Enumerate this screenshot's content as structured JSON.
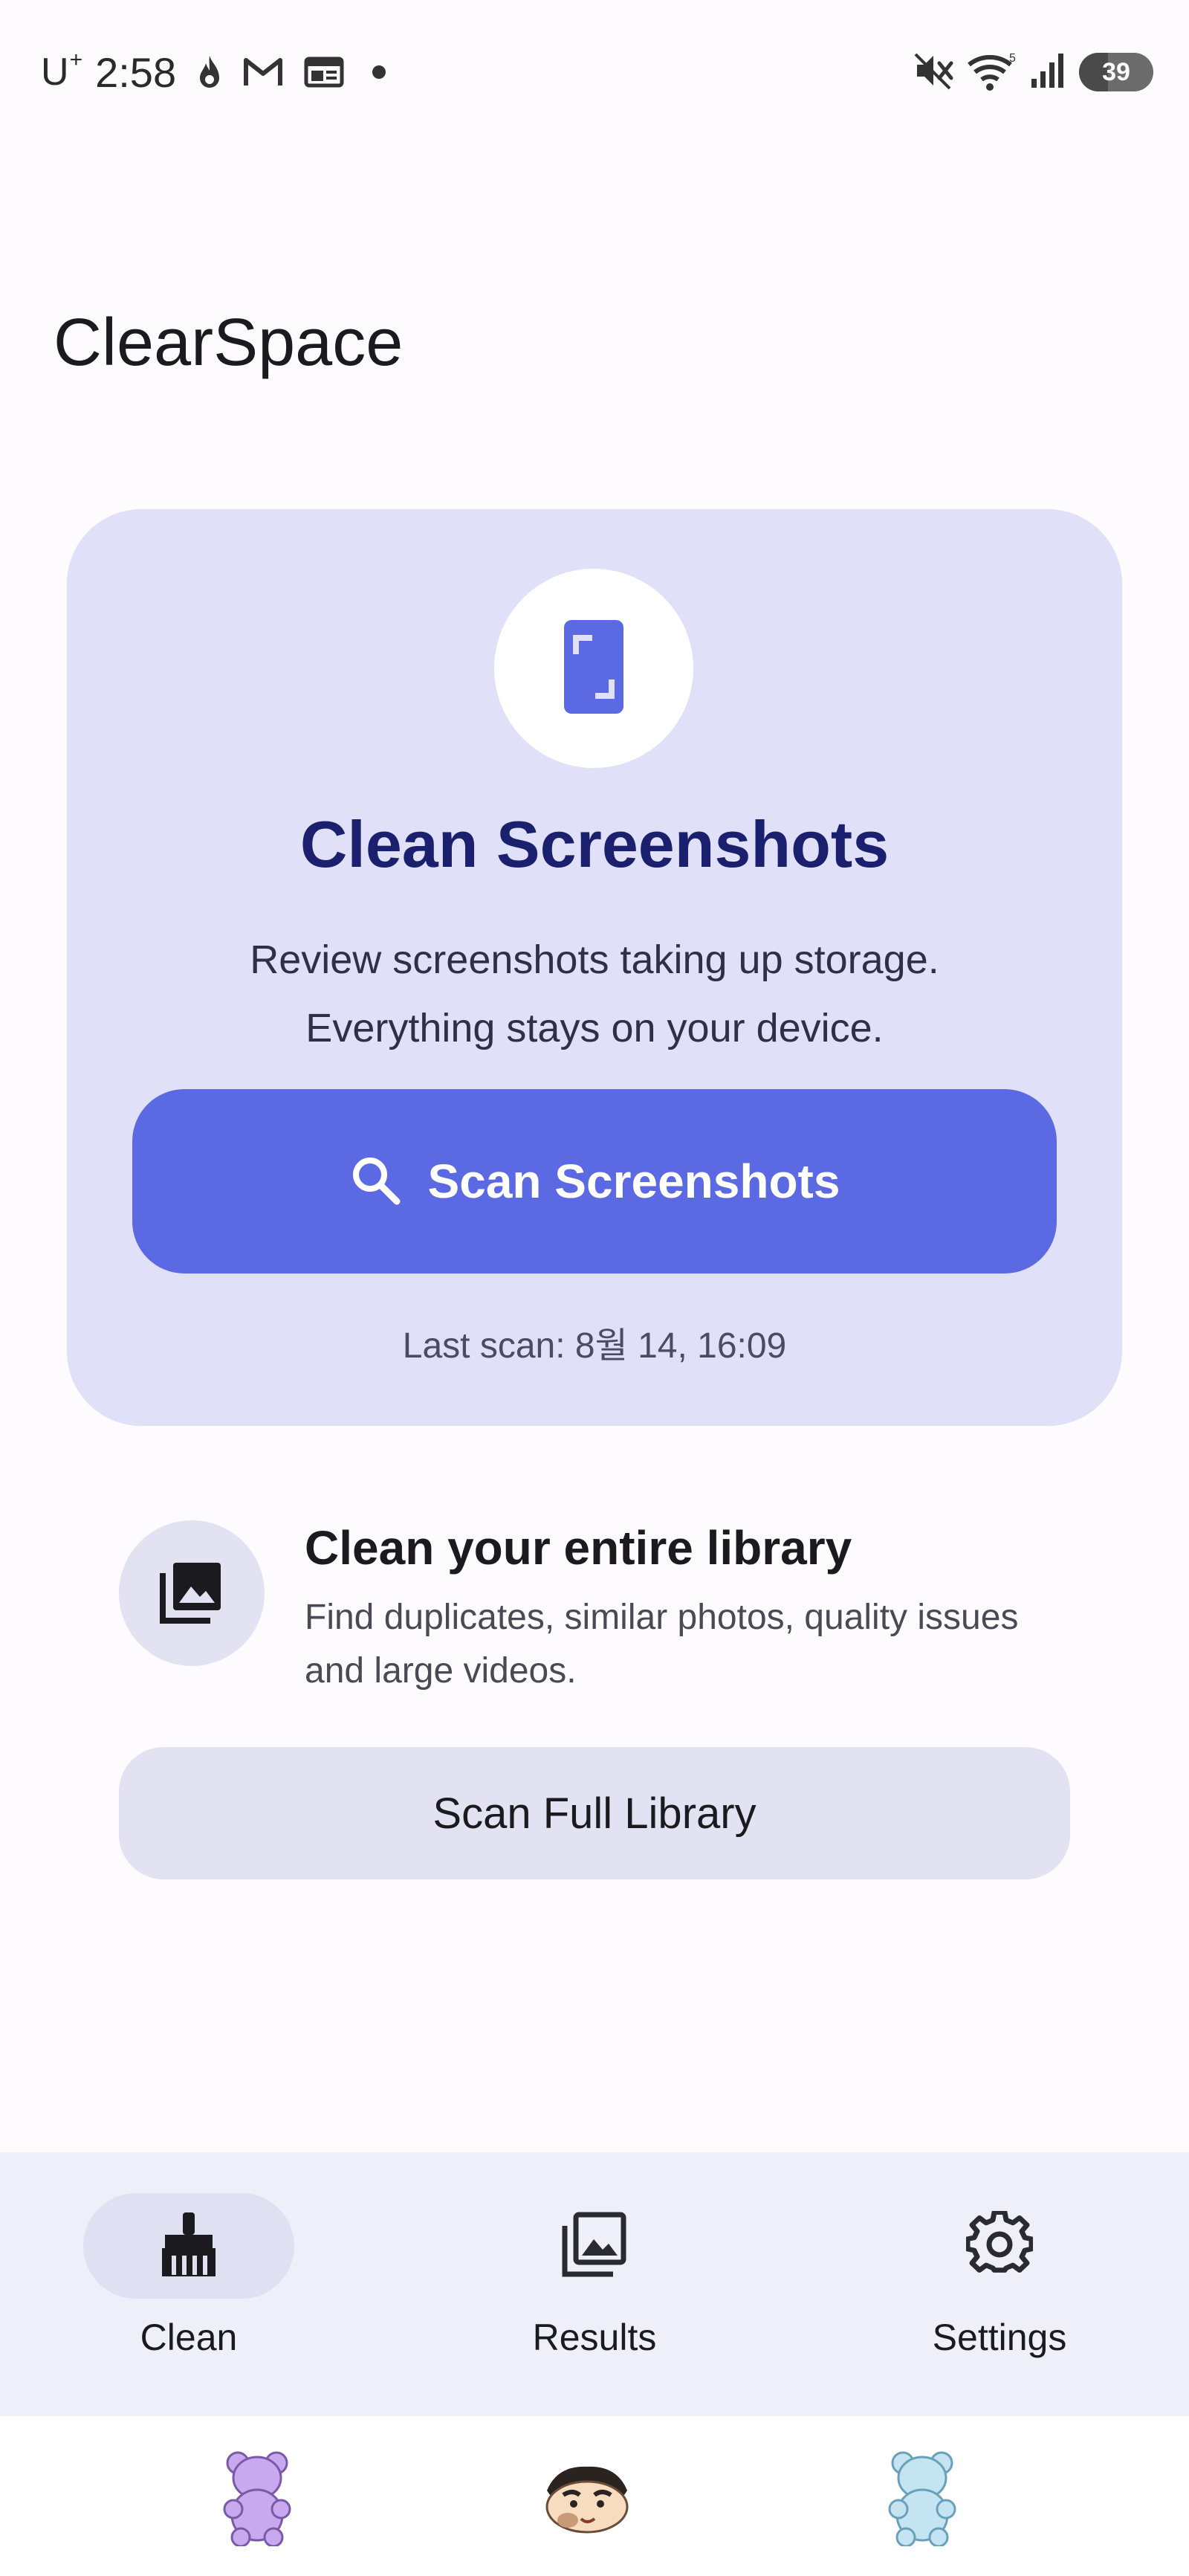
{
  "status_bar": {
    "carrier": "U",
    "carrier_sup": "+",
    "time": "2:58",
    "battery_level": "39",
    "icons": [
      "fire-notification-icon",
      "gmail-icon",
      "news-icon",
      "dot-icon",
      "mute-icon",
      "wifi-icon",
      "signal-icon",
      "battery-icon"
    ]
  },
  "app": {
    "title": "ClearSpace"
  },
  "hero": {
    "icon": "screenshot-phone-icon",
    "title": "Clean Screenshots",
    "desc_line1": "Review screenshots taking up storage.",
    "desc_line2": "Everything stays on your device.",
    "button_icon": "search-icon",
    "button_label": "Scan Screenshots",
    "last_scan": "Last scan: 8월 14, 16:09"
  },
  "library": {
    "icon": "photo-library-icon",
    "title": "Clean your entire library",
    "description": "Find duplicates, similar photos, quality issues and large videos.",
    "button_label": "Scan Full Library"
  },
  "nav": {
    "items": [
      {
        "label": "Clean",
        "icon": "broom-icon",
        "active": true
      },
      {
        "label": "Results",
        "icon": "gallery-icon",
        "active": false
      },
      {
        "label": "Settings",
        "icon": "gear-icon",
        "active": false
      }
    ]
  },
  "colors": {
    "accent": "#5b6ae3",
    "card_bg": "#e0e0f8",
    "hero_title": "#1a1f6e",
    "nav_bg": "#efeff9"
  }
}
